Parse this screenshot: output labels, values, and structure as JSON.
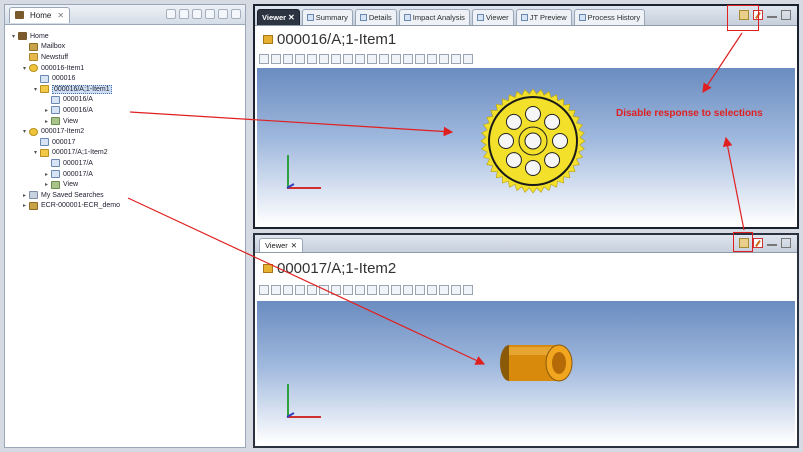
{
  "home_view": {
    "tab_label": "Home",
    "tree": [
      {
        "label": "Home",
        "indent": 0,
        "icon": "home-icon",
        "twisty": "▾"
      },
      {
        "label": "Mailbox",
        "indent": 1,
        "icon": "mailbox-icon",
        "twisty": ""
      },
      {
        "label": "Newstuff",
        "indent": 1,
        "icon": "folder-icon",
        "twisty": ""
      },
      {
        "label": "000016-Item1",
        "indent": 1,
        "icon": "item-icon",
        "twisty": "▾"
      },
      {
        "label": "000016",
        "indent": 2,
        "icon": "master-icon",
        "twisty": ""
      },
      {
        "label": "000016/A;1-Item1",
        "indent": 2,
        "icon": "revision-icon",
        "twisty": "▾",
        "selected": true
      },
      {
        "label": "000016/A",
        "indent": 3,
        "icon": "dataset-icon",
        "twisty": ""
      },
      {
        "label": "000016/A",
        "indent": 3,
        "icon": "dataset-icon",
        "twisty": "▸"
      },
      {
        "label": "View",
        "indent": 3,
        "icon": "view-icon",
        "twisty": "▸"
      },
      {
        "label": "000017-Item2",
        "indent": 1,
        "icon": "item-icon",
        "twisty": "▾"
      },
      {
        "label": "000017",
        "indent": 2,
        "icon": "master-icon",
        "twisty": ""
      },
      {
        "label": "000017/A;1-Item2",
        "indent": 2,
        "icon": "revision-icon",
        "twisty": "▾"
      },
      {
        "label": "000017/A",
        "indent": 3,
        "icon": "dataset-icon",
        "twisty": ""
      },
      {
        "label": "000017/A",
        "indent": 3,
        "icon": "dataset-icon",
        "twisty": "▸"
      },
      {
        "label": "View",
        "indent": 3,
        "icon": "view-icon",
        "twisty": "▸"
      },
      {
        "label": "My Saved Searches",
        "indent": 1,
        "icon": "search-icon",
        "twisty": "▸"
      },
      {
        "label": "ECR-000001-ECR_demo",
        "indent": 1,
        "icon": "change-icon",
        "twisty": "▸"
      }
    ]
  },
  "top_pane": {
    "tabs": [
      {
        "label": "Viewer",
        "active": true
      },
      {
        "label": "Summary",
        "active": false
      },
      {
        "label": "Details",
        "active": false
      },
      {
        "label": "Impact Analysis",
        "active": false
      },
      {
        "label": "Viewer",
        "active": false
      },
      {
        "label": "JT Preview",
        "active": false
      },
      {
        "label": "Process History",
        "active": false
      }
    ],
    "title": "000016/A;1-Item1"
  },
  "bottom_pane": {
    "tab_label": "Viewer",
    "title": "000017/A;1-Item2"
  },
  "annotation": {
    "text": "Disable response to selections",
    "color": "#e02020"
  },
  "colors": {
    "gear": "#f2e02a",
    "tube": "#e59a10",
    "arrow": "#e02020"
  }
}
